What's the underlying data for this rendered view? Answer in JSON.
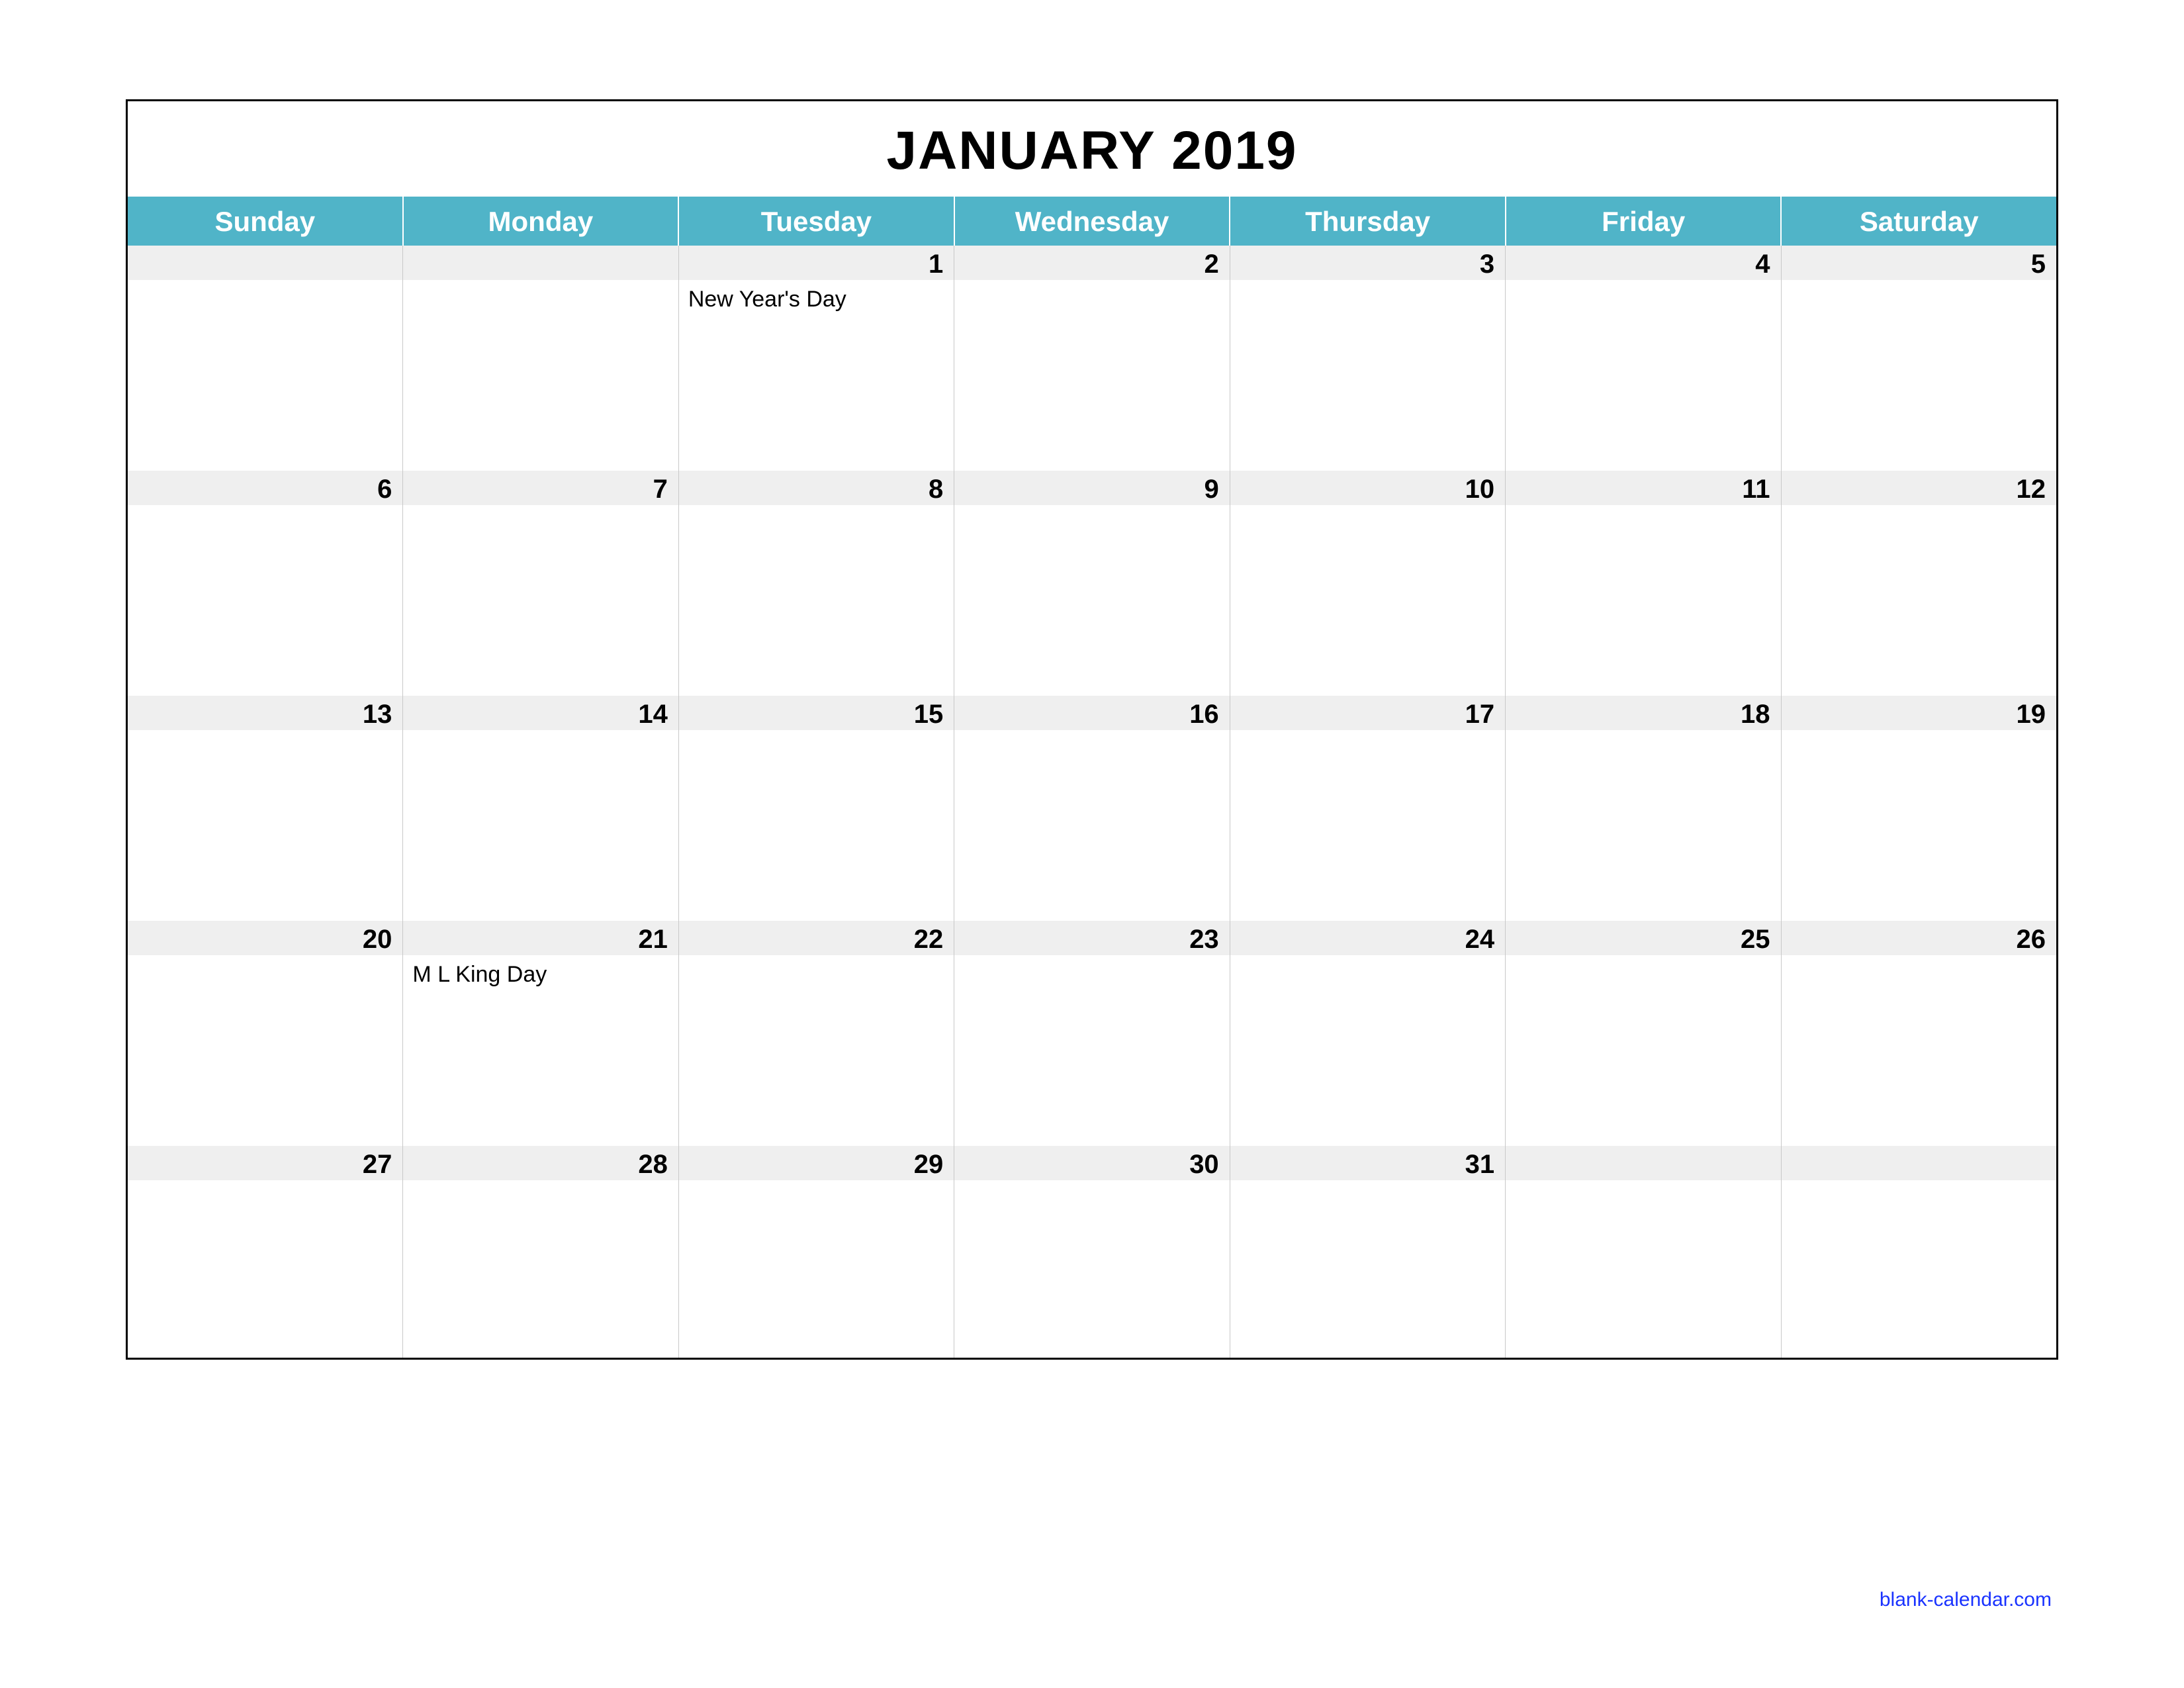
{
  "title": "JANUARY 2019",
  "daysOfWeek": [
    "Sunday",
    "Monday",
    "Tuesday",
    "Wednesday",
    "Thursday",
    "Friday",
    "Saturday"
  ],
  "weeks": [
    [
      {
        "num": "",
        "event": ""
      },
      {
        "num": "",
        "event": ""
      },
      {
        "num": "1",
        "event": "New Year's Day"
      },
      {
        "num": "2",
        "event": ""
      },
      {
        "num": "3",
        "event": ""
      },
      {
        "num": "4",
        "event": ""
      },
      {
        "num": "5",
        "event": ""
      }
    ],
    [
      {
        "num": "6",
        "event": ""
      },
      {
        "num": "7",
        "event": ""
      },
      {
        "num": "8",
        "event": ""
      },
      {
        "num": "9",
        "event": ""
      },
      {
        "num": "10",
        "event": ""
      },
      {
        "num": "11",
        "event": ""
      },
      {
        "num": "12",
        "event": ""
      }
    ],
    [
      {
        "num": "13",
        "event": ""
      },
      {
        "num": "14",
        "event": ""
      },
      {
        "num": "15",
        "event": ""
      },
      {
        "num": "16",
        "event": ""
      },
      {
        "num": "17",
        "event": ""
      },
      {
        "num": "18",
        "event": ""
      },
      {
        "num": "19",
        "event": ""
      }
    ],
    [
      {
        "num": "20",
        "event": ""
      },
      {
        "num": "21",
        "event": "M L King Day"
      },
      {
        "num": "22",
        "event": ""
      },
      {
        "num": "23",
        "event": ""
      },
      {
        "num": "24",
        "event": ""
      },
      {
        "num": "25",
        "event": ""
      },
      {
        "num": "26",
        "event": ""
      }
    ],
    [
      {
        "num": "27",
        "event": ""
      },
      {
        "num": "28",
        "event": ""
      },
      {
        "num": "29",
        "event": ""
      },
      {
        "num": "30",
        "event": ""
      },
      {
        "num": "31",
        "event": ""
      },
      {
        "num": "",
        "event": ""
      },
      {
        "num": "",
        "event": ""
      }
    ]
  ],
  "footer": "blank-calendar.com",
  "colors": {
    "headerBg": "#50b4c8",
    "dayNumBg": "#efefef",
    "link": "#1a33ff"
  }
}
